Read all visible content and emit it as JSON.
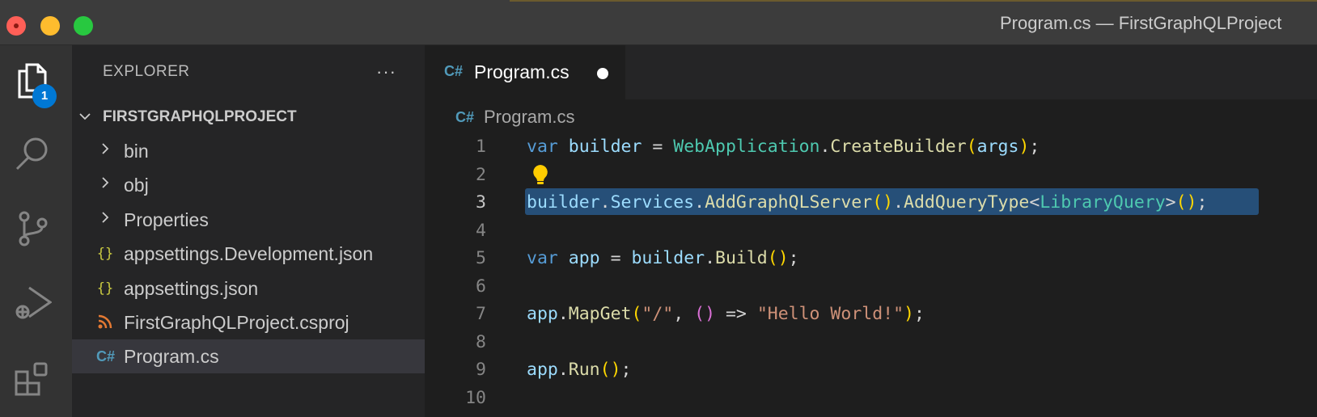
{
  "window": {
    "title": "Program.cs — FirstGraphQLProject"
  },
  "activity_bar": {
    "explorer_badge": "1",
    "items": [
      "explorer-icon",
      "search-icon",
      "source-control-icon",
      "run-debug-icon",
      "extensions-icon"
    ]
  },
  "sidebar": {
    "header": "EXPLORER",
    "more_actions": "···",
    "project_name": "FIRSTGRAPHQLPROJECT",
    "items": [
      {
        "label": "bin",
        "icon": "chevron-right-icon",
        "type": "folder"
      },
      {
        "label": "obj",
        "icon": "chevron-right-icon",
        "type": "folder"
      },
      {
        "label": "Properties",
        "icon": "chevron-right-icon",
        "type": "folder"
      },
      {
        "label": "appsettings.Development.json",
        "icon_text": "{}",
        "type": "json"
      },
      {
        "label": "appsettings.json",
        "icon_text": "{}",
        "type": "json"
      },
      {
        "label": "FirstGraphQLProject.csproj",
        "icon": "rss-icon",
        "type": "csproj"
      },
      {
        "label": "Program.cs",
        "icon_text": "C#",
        "type": "csharp",
        "selected": true
      }
    ]
  },
  "editor": {
    "tab": {
      "label": "Program.cs",
      "icon_text": "C#",
      "dirty": true
    },
    "breadcrumb": {
      "label": "Program.cs",
      "icon_text": "C#"
    },
    "line_numbers": [
      "1",
      "2",
      "3",
      "4",
      "5",
      "6",
      "7",
      "8",
      "9",
      "10"
    ],
    "active_line": 3,
    "code": {
      "l1": {
        "kw": "var",
        "v1": " builder",
        "op1": " = ",
        "ty": "WebApplication",
        "dot": ".",
        "fn": "CreateBuilder",
        "p1": "(",
        "arg": "args",
        "p2": ")",
        "end": ";"
      },
      "l3": {
        "v1": "builder",
        "dot1": ".",
        "v2": "Services",
        "dot2": ".",
        "fn1": "AddGraphQLServer",
        "p1": "()",
        "dot3": ".",
        "fn2": "AddQueryType",
        "lt": "<",
        "ty": "LibraryQuery",
        "gt": ">",
        "p2": "()",
        "end": ";"
      },
      "l5": {
        "kw": "var",
        "v1": " app",
        "op1": " = ",
        "v2": "builder",
        "dot": ".",
        "fn": "Build",
        "p": "()",
        "end": ";"
      },
      "l7": {
        "v1": "app",
        "dot": ".",
        "fn": "MapGet",
        "p1": "(",
        "s1": "\"/\"",
        "comma": ", ",
        "p2": "()",
        "arrow": " => ",
        "s2": "\"Hello World!\"",
        "p3": ")",
        "end": ";"
      },
      "l9": {
        "v1": "app",
        "dot": ".",
        "fn": "Run",
        "p": "()",
        "end": ";"
      }
    }
  },
  "colors": {
    "keyword": "#569cd6",
    "variable": "#9cdcfe",
    "type": "#4ec9b0",
    "function": "#dcdcaa",
    "string": "#ce9178",
    "bracket": "#ffd700",
    "bracket_nested": "#da70d6",
    "selection": "#264f78",
    "badge": "#0078d4"
  }
}
